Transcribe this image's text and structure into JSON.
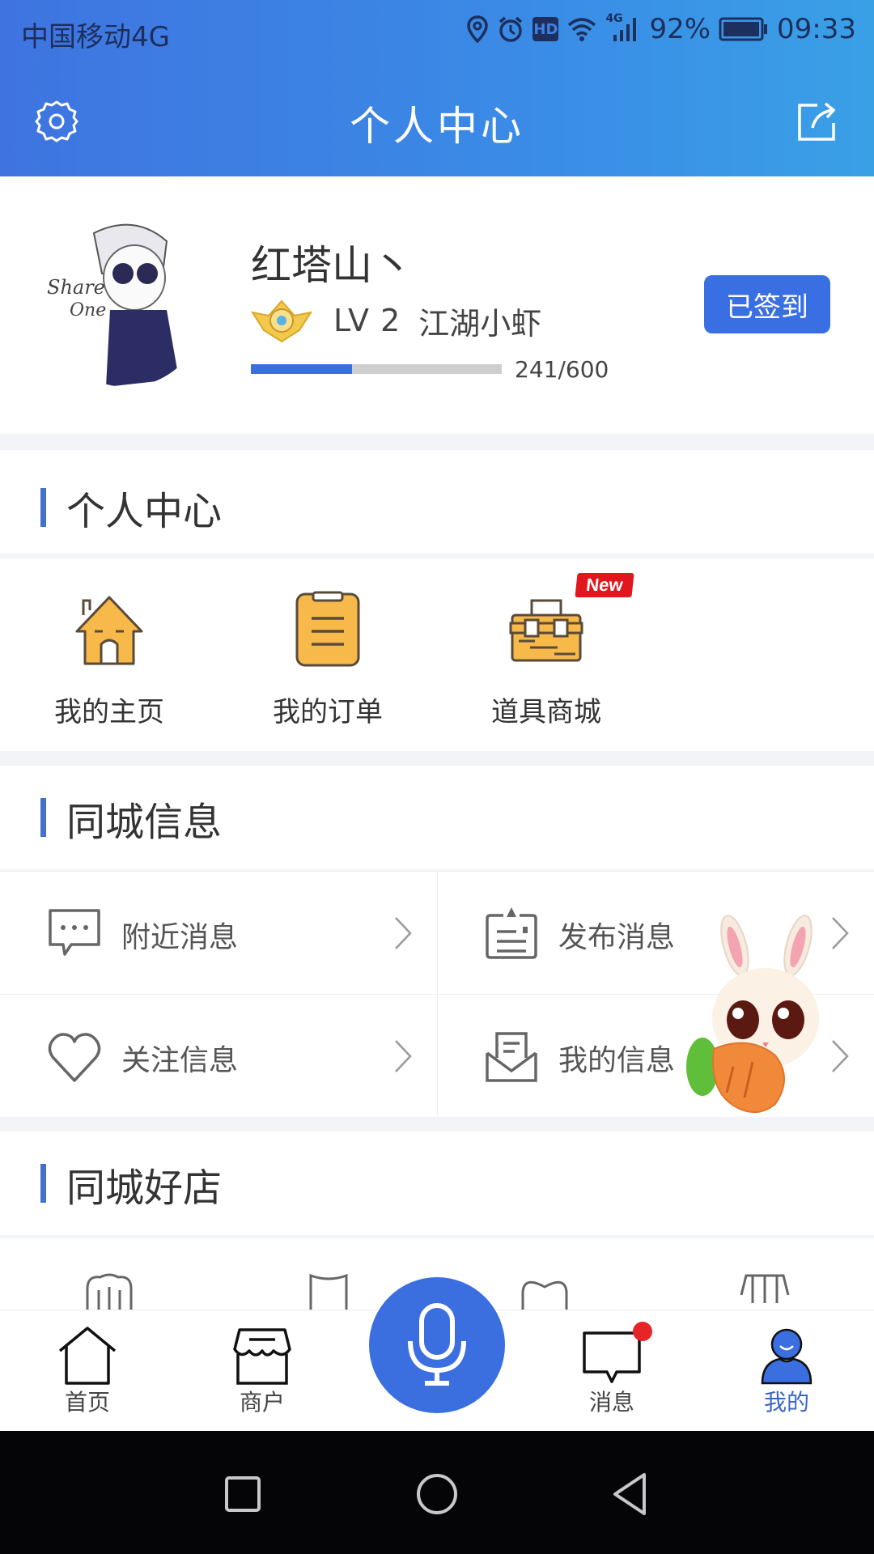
{
  "status_bar": {
    "carrier": "中国移动4G",
    "network_badge": "4G",
    "hd_badge": "HD",
    "battery_percent": "92%",
    "time": "09:33",
    "icons": [
      "location-icon",
      "alarm-icon",
      "hd-icon",
      "wifi-icon",
      "signal-icon",
      "battery-icon"
    ]
  },
  "header": {
    "title": "个人中心",
    "left_icon": "gear-icon",
    "right_icon": "share-icon",
    "gradient_colors": [
      "#3f74e0",
      "#3aa0e6"
    ]
  },
  "profile": {
    "avatar_text": [
      "Share",
      "One"
    ],
    "username": "红塔山丶",
    "level": "LV 2",
    "level_title": "江湖小虾",
    "exp_current": 241,
    "exp_max": 600,
    "exp_label": "241/600",
    "signin_label": "已签到"
  },
  "sections": {
    "personal": {
      "title": "个人中心",
      "items": [
        {
          "label": "我的主页",
          "icon": "home-icon"
        },
        {
          "label": "我的订单",
          "icon": "order-clipboard-icon"
        },
        {
          "label": "道具商城",
          "icon": "toolbox-icon",
          "badge": "New"
        }
      ]
    },
    "city_info": {
      "title": "同城信息",
      "items": [
        {
          "label": "附近消息",
          "icon": "chat-bubble-icon"
        },
        {
          "label": "发布消息",
          "icon": "publish-icon"
        },
        {
          "label": "关注信息",
          "icon": "heart-icon"
        },
        {
          "label": "我的信息",
          "icon": "mail-open-icon"
        }
      ]
    },
    "city_shops": {
      "title": "同城好店"
    }
  },
  "tabbar": {
    "items": [
      {
        "label": "首页",
        "icon": "home-icon",
        "active": false
      },
      {
        "label": "商户",
        "icon": "store-icon",
        "active": false
      },
      {
        "label": "消息",
        "icon": "message-icon",
        "active": false,
        "has_dot": true
      },
      {
        "label": "我的",
        "icon": "user-icon",
        "active": true
      }
    ],
    "center_button": "microphone-icon",
    "accent_color": "#3b6fe0"
  },
  "system_nav": [
    "recents-icon",
    "home-circle-icon",
    "back-icon"
  ]
}
